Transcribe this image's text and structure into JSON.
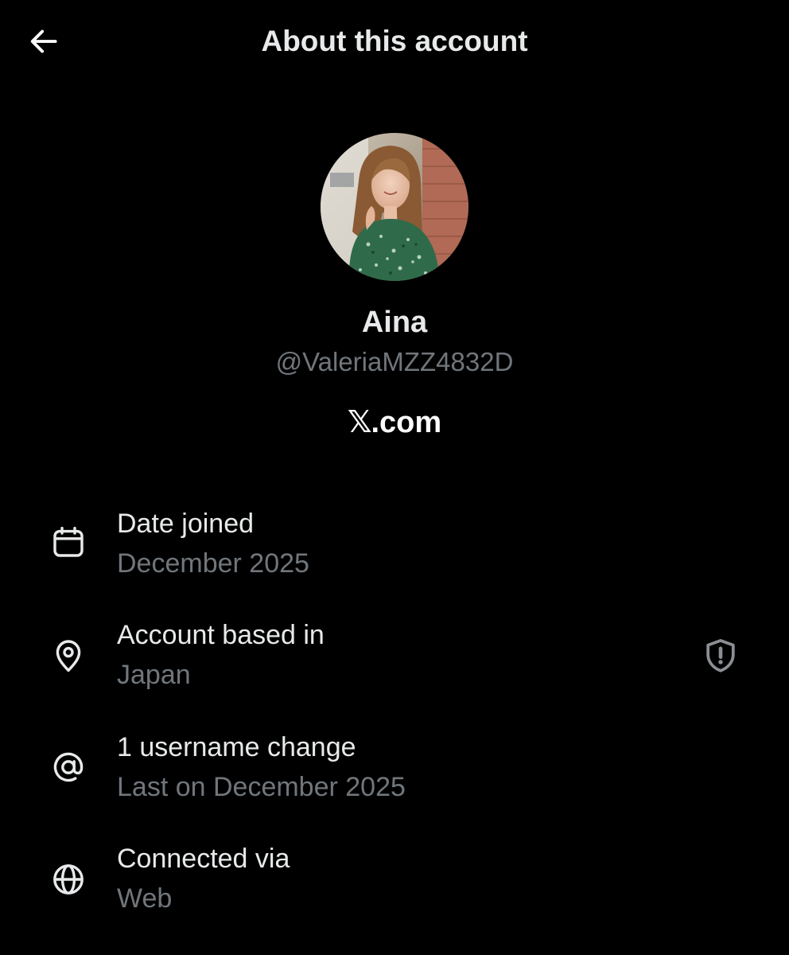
{
  "header": {
    "title": "About this account",
    "back_icon": "arrow-left-icon"
  },
  "profile": {
    "display_name": "Aina",
    "handle": "@ValeriaMZZ4832D",
    "source_mark": "𝕏",
    "source_text": ".com"
  },
  "details": [
    {
      "icon": "calendar-icon",
      "title": "Date joined",
      "value": "December 2025"
    },
    {
      "icon": "location-pin-icon",
      "title": "Account based in",
      "value": "Japan",
      "badge_icon": "shield-alert-icon"
    },
    {
      "icon": "at-sign-icon",
      "title": "1 username change",
      "value": "Last on December 2025"
    },
    {
      "icon": "globe-icon",
      "title": "Connected via",
      "value": "Web"
    }
  ],
  "colors": {
    "background": "#000000",
    "primary_text": "#e7e9ea",
    "secondary_text": "#71767b"
  }
}
